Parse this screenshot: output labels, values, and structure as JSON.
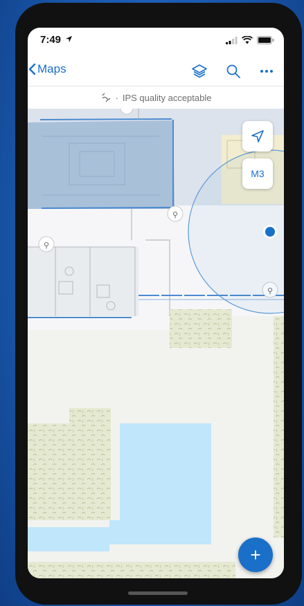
{
  "status_bar": {
    "time": "7:49"
  },
  "nav": {
    "back_label": "Maps",
    "layers_icon": "layers-icon",
    "search_icon": "search-icon",
    "more_icon": "more-icon"
  },
  "ips_banner": {
    "separator": "·",
    "text": "IPS quality acceptable"
  },
  "map_controls": {
    "locate_icon": "location-arrow-icon",
    "level_label": "M3"
  },
  "fab": {
    "label": "+"
  },
  "colors": {
    "accent": "#1a6fc9",
    "room_highlight": "#a9c0d9",
    "water": "#bfe6fb",
    "vegetation": "#e6e9d2",
    "location_dot": "#1a6fc9"
  }
}
